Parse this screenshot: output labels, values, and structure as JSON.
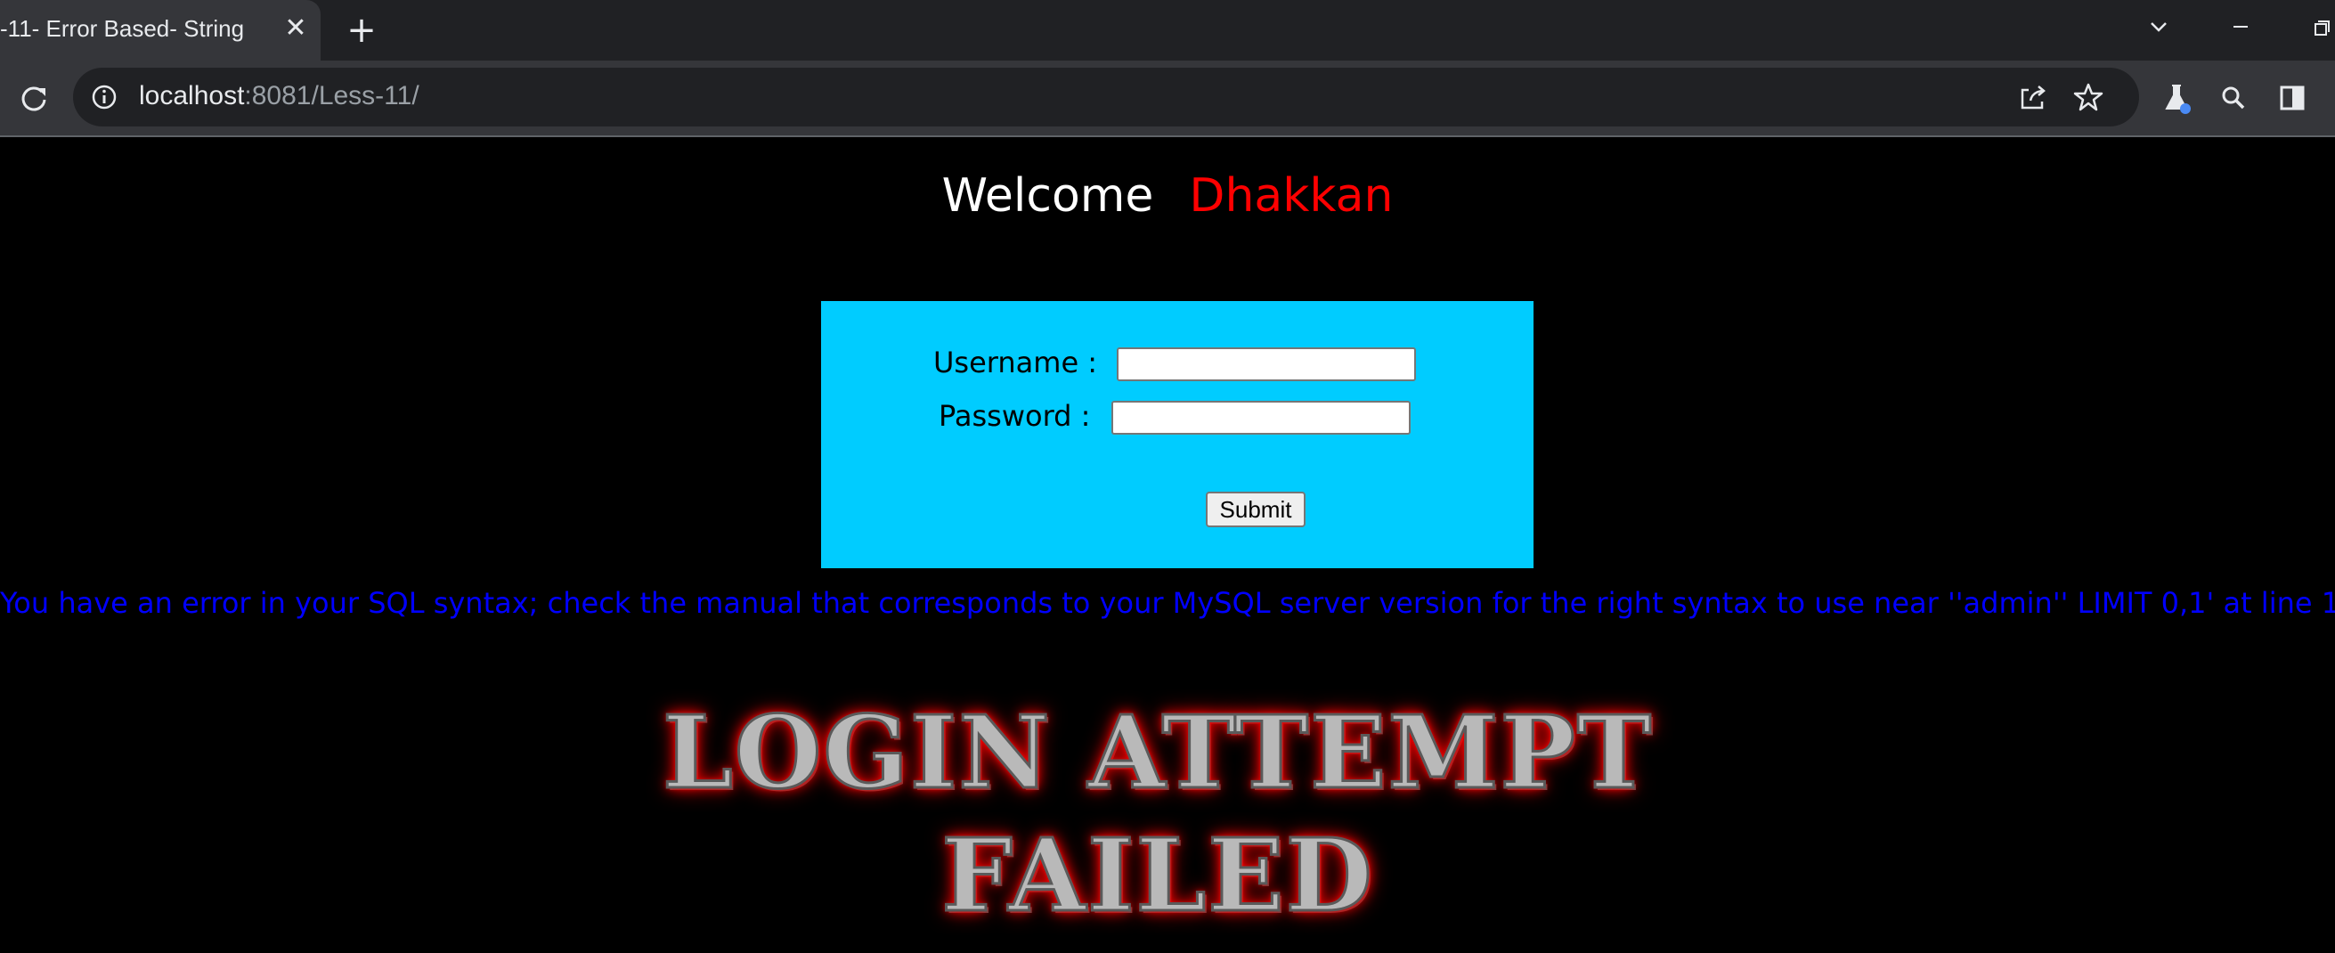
{
  "browser": {
    "tab_title": "-11- Error Based- String",
    "url_host": "localhost",
    "url_path": ":8081/Less-11/",
    "icons": [
      "close-icon",
      "new-tab-icon",
      "chevron-down-icon",
      "minimize-icon",
      "restore-icon",
      "reload-icon",
      "site-info-icon",
      "share-icon",
      "bookmark-star-icon",
      "labs-icon",
      "search-icon",
      "sidebar-icon"
    ]
  },
  "page": {
    "welcome": "Welcome",
    "name": "Dhakkan",
    "form": {
      "username_label": "Username :",
      "password_label": "Password :",
      "username_value": "",
      "password_value": "",
      "submit_label": "Submit"
    },
    "error_message": "You have an error in your SQL syntax; check the manual that corresponds to your MySQL server version for the right syntax to use near ''admin'' LIMIT 0,1' at line 1",
    "banner_line1": "LOGIN ATTEMPT",
    "banner_line2": "FAILED",
    "colors": {
      "background": "#000000",
      "panel": "#00ccff",
      "welcome_name": "#ff0000",
      "error_text": "#0000ff"
    }
  }
}
